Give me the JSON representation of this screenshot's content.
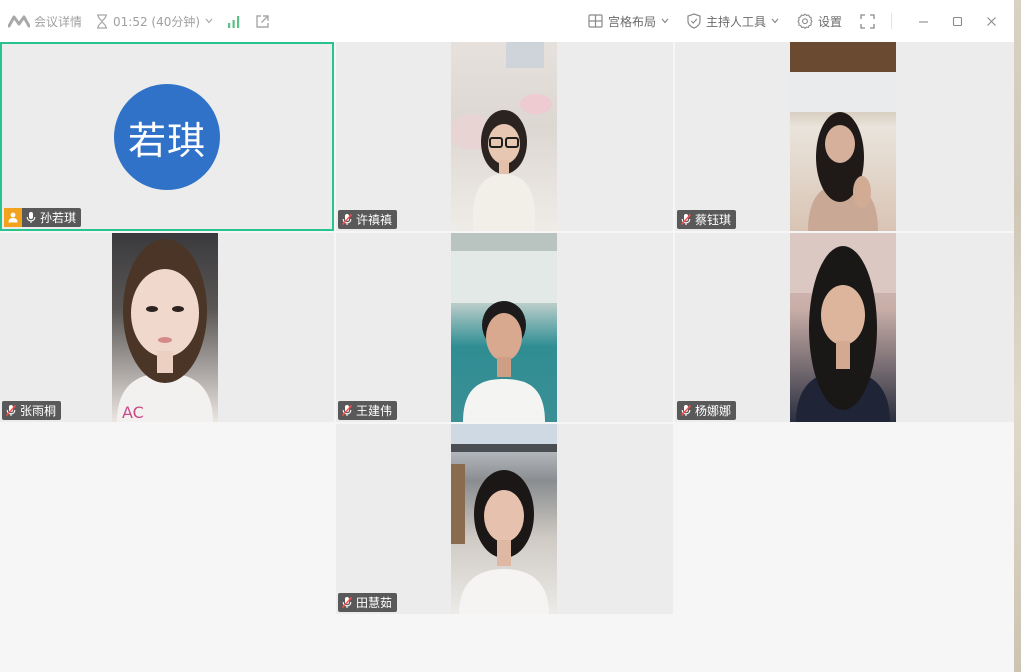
{
  "titlebar": {
    "meeting_info_label": "会议详情",
    "timer": "01:52 (40分钟)",
    "right": {
      "layout_label": "宫格布局",
      "host_tools_label": "主持人工具",
      "settings_label": "设置"
    }
  },
  "colors": {
    "accent_green": "#28c48e",
    "avatar_blue": "#2f72c7",
    "host_orange": "#f2a21d",
    "signal_green": "#5cc08a"
  },
  "participants": [
    {
      "name": "孙若琪",
      "avatar_text": "若琪",
      "muted": false,
      "host": true,
      "active_speaker": true,
      "video": false
    },
    {
      "name": "许禛禛",
      "muted": true,
      "video": true
    },
    {
      "name": "蔡钰琪",
      "muted": true,
      "video": true
    },
    {
      "name": "张雨桐",
      "muted": true,
      "video": true
    },
    {
      "name": "王建伟",
      "muted": true,
      "video": true
    },
    {
      "name": "杨娜娜",
      "muted": true,
      "video": true
    },
    {
      "name": "田慧茹",
      "muted": true,
      "video": true
    }
  ]
}
